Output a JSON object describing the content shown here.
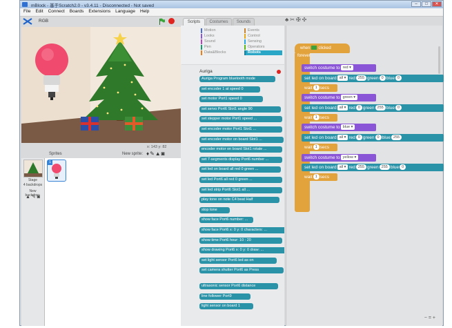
{
  "window": {
    "title": "mBlock - 基于Scratch2.0 - v3.4.11 - Disconnected - Not saved",
    "controls": [
      "–",
      "□",
      "✕"
    ]
  },
  "menubar": [
    "File",
    "Edit",
    "Connect",
    "Boards",
    "Extensions",
    "Language",
    "Help"
  ],
  "stage": {
    "sprite_name": "RGB"
  },
  "sprites_panel": {
    "label": "Sprites",
    "new_sprite_label": "New sprite:",
    "coords": "x: 143  y: 82",
    "stage_label": "Stage",
    "stage_sub": "4 backdrops",
    "new_backdrop_label": "New backdrop:",
    "sprite_number": "1"
  },
  "tabs": [
    "Scripts",
    "Costumes",
    "Sounds"
  ],
  "categories": {
    "left": [
      {
        "label": "Motion",
        "color": "#4a6cd4"
      },
      {
        "label": "Looks",
        "color": "#8a55d6"
      },
      {
        "label": "Sound",
        "color": "#bb42c3"
      },
      {
        "label": "Pen",
        "color": "#0e9a6c"
      },
      {
        "label": "Data&Blocks",
        "color": "#ee7d16"
      }
    ],
    "right": [
      {
        "label": "Events",
        "color": "#c88330"
      },
      {
        "label": "Control",
        "color": "#e1a91a"
      },
      {
        "label": "Sensing",
        "color": "#2ca5e2"
      },
      {
        "label": "Operators",
        "color": "#5cb712"
      },
      {
        "label": "Robots",
        "color": "#2aa6c7"
      }
    ],
    "selected": "Robots"
  },
  "palette": {
    "title": "Auriga",
    "blocks": [
      "Auriga Program  bluetooth mode",
      "set encoder  1 at speed  0",
      "set motor  Port1  speed  0",
      "set servo  Port6  Slot1  angle  90",
      "set stepper motor  Port1  speed  ...",
      "set encoder motor  Port1  Slot1  ...",
      "set encoder motor on board  Slot1  ...",
      "encoder motor on board  Slot1  rotate  ...",
      "set 7-segments display  Port6  number  ...",
      "set led on board  all  red  0  green  ...",
      "set led  Port6  all  red  0  green  ...",
      "set led strip  Port6  Slot1  all  ...",
      "play tone on note  C4  beat  Half",
      "stop tone",
      "show face  Port6  number:  ...",
      "show face  Port6  x: 0  y: 0  characters: ...",
      "show time  Port6  hour:  10  :  20",
      "show drawing  Port6  x: 0  y: 0  draw: ...",
      "set light sensor  Port6  led as  on",
      "set camera shutter  Port6  as  Press",
      "ultrasonic sensor  Port6  distance",
      "line follower  Port9",
      "light sensor  on board 1"
    ]
  },
  "script": {
    "hat": "when",
    "hat_suffix": "clicked",
    "forever": "forever",
    "blocks": [
      {
        "type": "look",
        "text": "switch costume to",
        "fields": [
          "red"
        ]
      },
      {
        "type": "rob",
        "text": "set led on board",
        "fields": [
          "all",
          "red",
          "255",
          "green",
          "0",
          "blue",
          "0"
        ]
      },
      {
        "type": "ctl",
        "text": "wait",
        "fields": [
          "1",
          "secs"
        ]
      },
      {
        "type": "look",
        "text": "switch costume to",
        "fields": [
          "green"
        ]
      },
      {
        "type": "rob",
        "text": "set led on board",
        "fields": [
          "all",
          "red",
          "0",
          "green",
          "255",
          "blue",
          "0"
        ]
      },
      {
        "type": "ctl",
        "text": "wait",
        "fields": [
          "1",
          "secs"
        ]
      },
      {
        "type": "look",
        "text": "switch costume to",
        "fields": [
          "blue"
        ]
      },
      {
        "type": "rob",
        "text": "set led on board",
        "fields": [
          "all",
          "red",
          "0",
          "green",
          "0",
          "blue",
          "255"
        ]
      },
      {
        "type": "ctl",
        "text": "wait",
        "fields": [
          "1",
          "secs"
        ]
      },
      {
        "type": "look",
        "text": "switch costume to",
        "fields": [
          "yellow"
        ]
      },
      {
        "type": "rob",
        "text": "set led on board",
        "fields": [
          "all",
          "red",
          "255",
          "green",
          "255",
          "blue",
          "0"
        ]
      },
      {
        "type": "ctl",
        "text": "wait",
        "fields": [
          "1",
          "secs"
        ]
      }
    ]
  },
  "zoom": [
    "−",
    "=",
    "+"
  ]
}
